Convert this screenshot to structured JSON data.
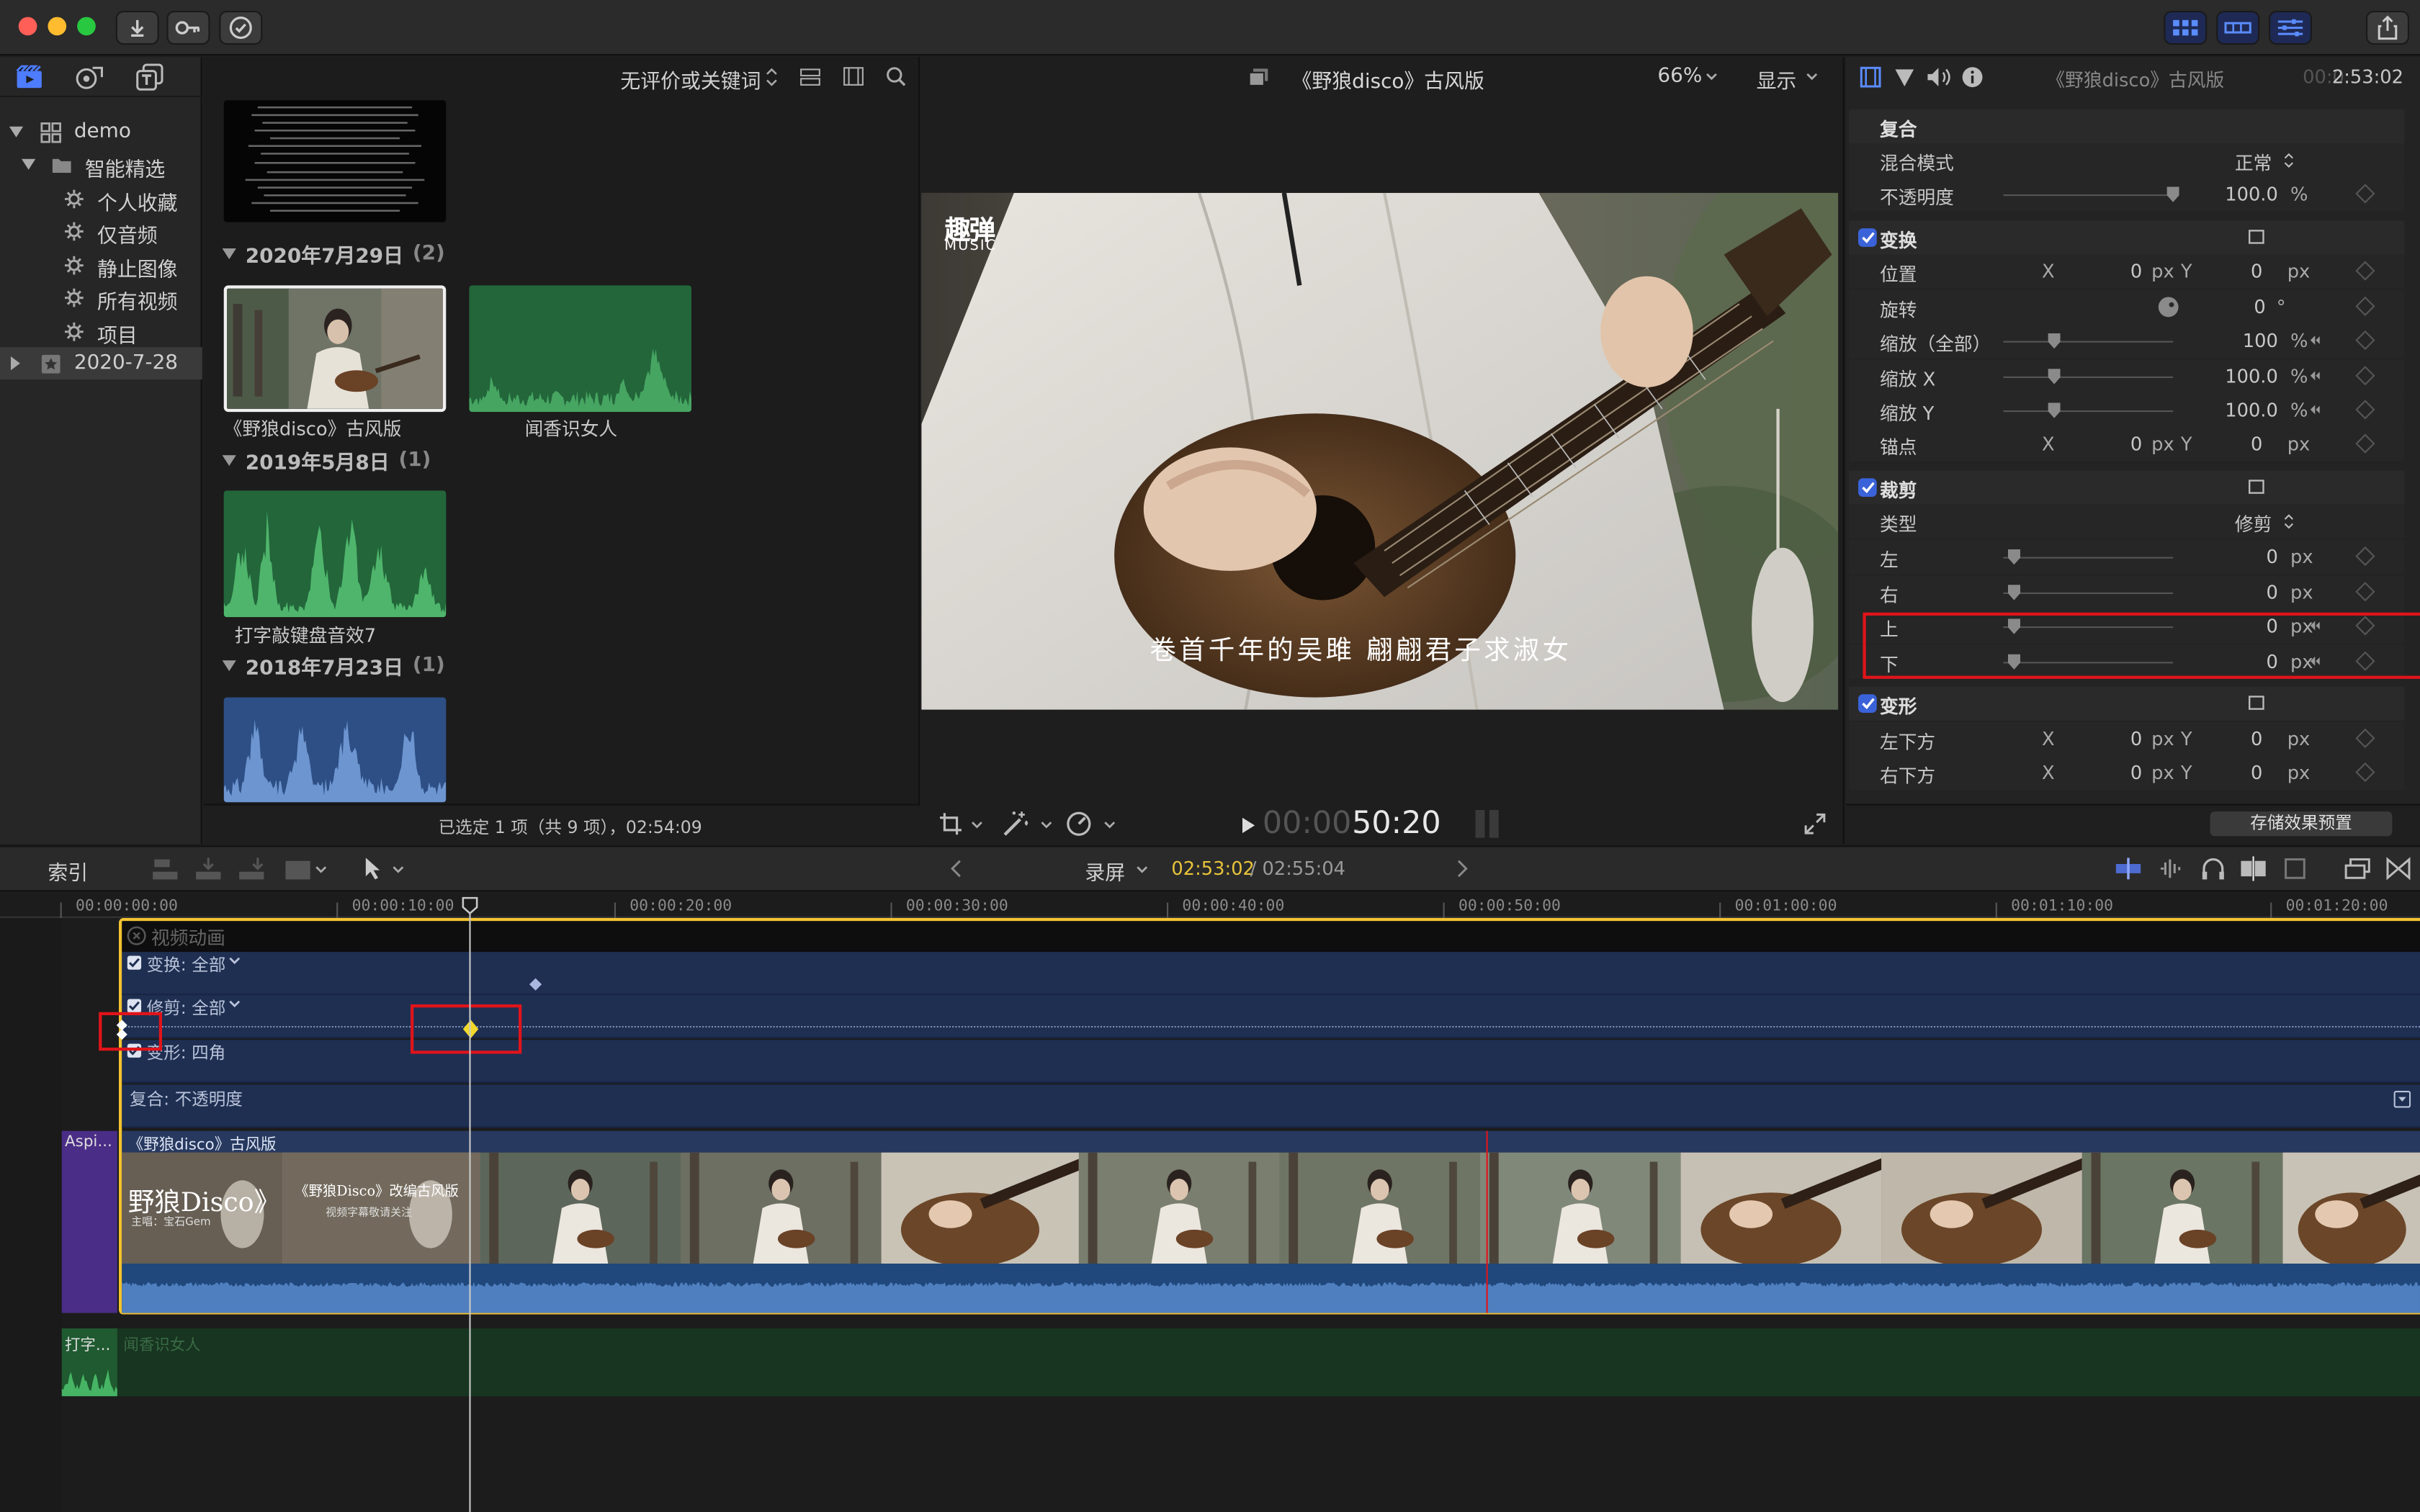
{
  "titlebar": {
    "icons": [
      "import-icon",
      "key-icon",
      "checkmark-circle-icon",
      "share-icon"
    ]
  },
  "sidebar": {
    "tabs": [
      "libraries-icon",
      "photos-audio-icon",
      "titles-generators-icon"
    ],
    "items": [
      {
        "label": "demo",
        "level": 0,
        "icon": "library-grid-icon"
      },
      {
        "label": "智能精选",
        "level": 1,
        "icon": "folder-icon"
      },
      {
        "label": "个人收藏",
        "level": 2,
        "icon": "gear-icon"
      },
      {
        "label": "仅音频",
        "level": 2,
        "icon": "gear-icon"
      },
      {
        "label": "静止图像",
        "level": 2,
        "icon": "gear-icon"
      },
      {
        "label": "所有视频",
        "level": 2,
        "icon": "gear-icon"
      },
      {
        "label": "项目",
        "level": 2,
        "icon": "gear-icon"
      },
      {
        "label": "2020-7-28",
        "level": 0,
        "icon": "event-star-icon"
      }
    ]
  },
  "browser": {
    "filter": "无评价或关键词",
    "groups": [
      {
        "date": "2020年7月29日",
        "count": "(2)",
        "clips": [
          "《野狼disco》古风版",
          "闻香识女人"
        ]
      },
      {
        "date": "2019年5月8日",
        "count": "(1)",
        "clips": [
          "打字敲键盘音效7"
        ]
      },
      {
        "date": "2018年7月23日",
        "count": "(1)",
        "clips": [
          ""
        ]
      }
    ],
    "status": "已选定 1 项（共 9 项），02:54:09"
  },
  "viewer": {
    "title": "《野狼disco》古风版",
    "zoom": "66%",
    "display": "显示",
    "logo_top": "趣弹",
    "logo_bottom": "MUSIC",
    "subtitle": "卷首千年的吴雎 翩翩君子求淑女",
    "timecode_dim": "00:00:",
    "timecode_bright": "50:20"
  },
  "inspector": {
    "clip_name": "《野狼disco》古风版",
    "time_dim": "00:0",
    "time": "2:53:02",
    "save_preset": "存储效果预置",
    "sections": {
      "composite": {
        "title": "复合",
        "blend_label": "混合模式",
        "blend_value": "正常",
        "opacity_label": "不透明度",
        "opacity_value": "100.0",
        "opacity_unit": "%"
      },
      "transform": {
        "title": "变换",
        "position": "位置",
        "rotation": "旋转",
        "scale_all": "缩放（全部）",
        "scale_x": "缩放 X",
        "scale_y": "缩放 Y",
        "anchor": "锚点",
        "pos_x": "0",
        "pos_y": "0",
        "rot": "0",
        "rot_unit": "°",
        "scale_all_v": "100",
        "scale_x_v": "100.0",
        "scale_y_v": "100.0",
        "anchor_x": "0",
        "anchor_y": "0"
      },
      "crop": {
        "title": "裁剪",
        "type_label": "类型",
        "type_value": "修剪",
        "left": "左",
        "right": "右",
        "top": "上",
        "bottom": "下",
        "left_v": "0",
        "right_v": "0",
        "top_v": "0",
        "bottom_v": "0"
      },
      "distort": {
        "title": "变形",
        "bottom_left": "左下方",
        "bottom_right": "右下方",
        "bl_x": "0",
        "bl_y": "0",
        "br_x": "0",
        "br_y": "0"
      }
    },
    "units": {
      "px": "px",
      "pct": "%",
      "x": "X",
      "y": "Y"
    }
  },
  "timeline_toolbar": {
    "index": "索引",
    "project": "录屏",
    "current": "02:53:02",
    "total": "/ 02:55:04"
  },
  "timeline": {
    "ruler": [
      "00:00:00:00",
      "00:00:10:00",
      "00:00:20:00",
      "00:00:30:00",
      "00:00:40:00",
      "00:00:50:00",
      "00:01:00:00",
      "00:01:10:00",
      "00:01:20:00"
    ],
    "anim_header": "视频动画",
    "anim_rows": [
      "变换: 全部",
      "修剪: 全部",
      "变形: 四角",
      "复合: 不透明度"
    ],
    "clip_name": "《野狼disco》古风版",
    "storyline_tag": "Aspi...",
    "title_card_1": "野狼Disco》",
    "title_card_1_sub": "主唱：宝石Gem",
    "title_card_2": "《野狼Disco》改编古风版",
    "title_card_2_sub": "视频字幕敬请关注",
    "audio_clip_tag": "打字...",
    "audio_clip_name": "闻香识女人"
  },
  "colors": {
    "accent": "#3b63d9",
    "clip_blue": "#1e2f52",
    "audio_green": "#1f3d26",
    "selection_yellow": "#f2c230",
    "highlight_red": "#e0141a"
  }
}
